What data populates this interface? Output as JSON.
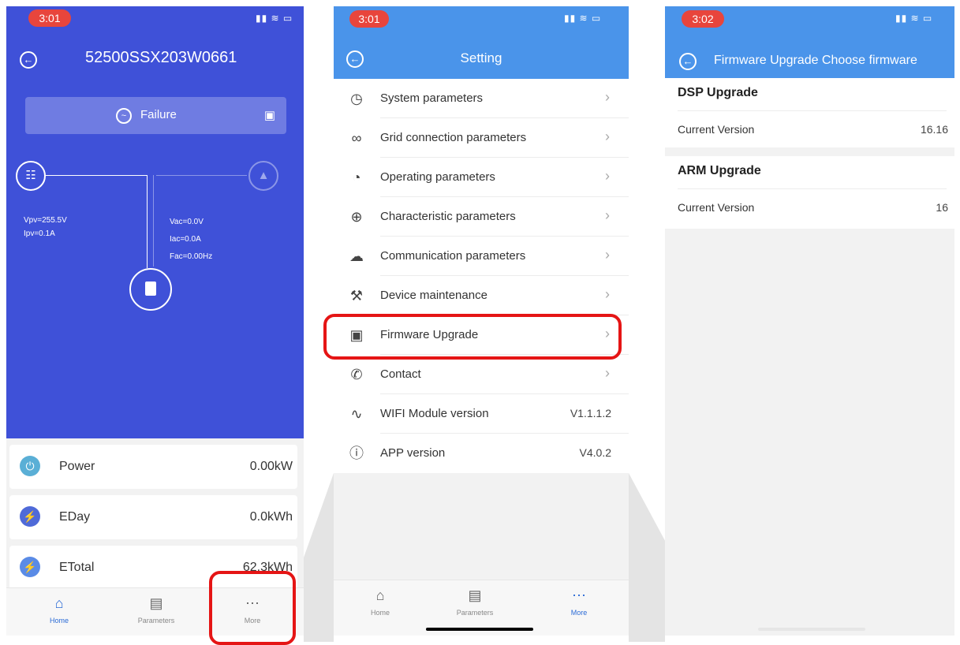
{
  "screen1": {
    "status": {
      "time": "3:01",
      "icons": "▮▮ ≋ ▭"
    },
    "title": "52500SSX203W0661",
    "failure_label": "Failure",
    "flow": {
      "pv_lines": [
        "Vpv=255.5V",
        "Ipv=0.1A"
      ],
      "ac_lines": [
        "Vac=0.0V",
        "Iac=0.0A",
        "Fac=0.00Hz"
      ]
    },
    "cards": [
      {
        "label": "Power",
        "value": "0.00kW",
        "icon": "power-icon",
        "color": "#5aafd6"
      },
      {
        "label": "EDay",
        "value": "0.0kWh",
        "icon": "lightning-icon",
        "color": "#4f6ad8"
      },
      {
        "label": "ETotal",
        "value": "62.3kWh",
        "icon": "lightning-icon",
        "color": "#5a8be6"
      }
    ],
    "tabs": [
      {
        "label": "Home",
        "icon": "home-icon",
        "active": true
      },
      {
        "label": "Parameters",
        "icon": "document-icon",
        "active": false
      },
      {
        "label": "More",
        "icon": "more-icon",
        "active": false
      }
    ]
  },
  "screen2": {
    "status": {
      "time": "3:01",
      "icons": "▮▮ ≋ ▭"
    },
    "title": "Setting",
    "items": [
      {
        "label": "System parameters",
        "icon": "clock-icon",
        "value": ""
      },
      {
        "label": "Grid connection parameters",
        "icon": "link-icon",
        "value": ""
      },
      {
        "label": "Operating parameters",
        "icon": "gauge-icon",
        "value": ""
      },
      {
        "label": "Characteristic parameters",
        "icon": "crosshair-icon",
        "value": ""
      },
      {
        "label": "Communication parameters",
        "icon": "cloud-upload-icon",
        "value": ""
      },
      {
        "label": "Device maintenance",
        "icon": "wrench-icon",
        "value": ""
      },
      {
        "label": "Firmware Upgrade",
        "icon": "chip-icon",
        "value": ""
      },
      {
        "label": "Contact",
        "icon": "phone-icon",
        "value": ""
      },
      {
        "label": "WIFI Module version",
        "icon": "wifi-icon",
        "value": "V1.1.1.2"
      },
      {
        "label": "APP version",
        "icon": "info-icon",
        "value": "V4.0.2"
      }
    ],
    "tabs": [
      {
        "label": "Home",
        "icon": "home-icon",
        "active": false
      },
      {
        "label": "Parameters",
        "icon": "document-icon",
        "active": false
      },
      {
        "label": "More",
        "icon": "more-icon",
        "active": true
      }
    ]
  },
  "screen3": {
    "status": {
      "time": "3:02",
      "icons": "▮▮ ≋ ▭"
    },
    "title": "Firmware Upgrade Choose firmware",
    "sections": [
      {
        "heading": "DSP Upgrade",
        "label": "Current Version",
        "value": "16.16"
      },
      {
        "heading": "ARM Upgrade",
        "label": "Current Version",
        "value": "16"
      }
    ]
  },
  "colors": {
    "screen1_bg": "#3f51d8",
    "header_blue": "#4a94ea",
    "highlight_red": "#e51515",
    "status_pill": "#e8453c"
  }
}
